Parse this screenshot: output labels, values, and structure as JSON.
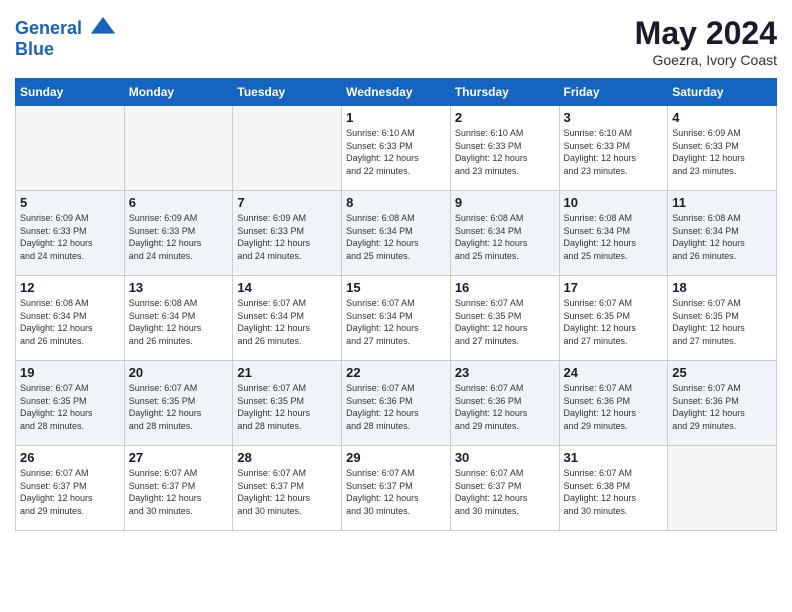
{
  "header": {
    "logo_line1": "General",
    "logo_line2": "Blue",
    "month_year": "May 2024",
    "location": "Goezra, Ivory Coast"
  },
  "weekdays": [
    "Sunday",
    "Monday",
    "Tuesday",
    "Wednesday",
    "Thursday",
    "Friday",
    "Saturday"
  ],
  "weeks": [
    [
      {
        "day": "",
        "info": ""
      },
      {
        "day": "",
        "info": ""
      },
      {
        "day": "",
        "info": ""
      },
      {
        "day": "1",
        "info": "Sunrise: 6:10 AM\nSunset: 6:33 PM\nDaylight: 12 hours\nand 22 minutes."
      },
      {
        "day": "2",
        "info": "Sunrise: 6:10 AM\nSunset: 6:33 PM\nDaylight: 12 hours\nand 23 minutes."
      },
      {
        "day": "3",
        "info": "Sunrise: 6:10 AM\nSunset: 6:33 PM\nDaylight: 12 hours\nand 23 minutes."
      },
      {
        "day": "4",
        "info": "Sunrise: 6:09 AM\nSunset: 6:33 PM\nDaylight: 12 hours\nand 23 minutes."
      }
    ],
    [
      {
        "day": "5",
        "info": "Sunrise: 6:09 AM\nSunset: 6:33 PM\nDaylight: 12 hours\nand 24 minutes."
      },
      {
        "day": "6",
        "info": "Sunrise: 6:09 AM\nSunset: 6:33 PM\nDaylight: 12 hours\nand 24 minutes."
      },
      {
        "day": "7",
        "info": "Sunrise: 6:09 AM\nSunset: 6:33 PM\nDaylight: 12 hours\nand 24 minutes."
      },
      {
        "day": "8",
        "info": "Sunrise: 6:08 AM\nSunset: 6:34 PM\nDaylight: 12 hours\nand 25 minutes."
      },
      {
        "day": "9",
        "info": "Sunrise: 6:08 AM\nSunset: 6:34 PM\nDaylight: 12 hours\nand 25 minutes."
      },
      {
        "day": "10",
        "info": "Sunrise: 6:08 AM\nSunset: 6:34 PM\nDaylight: 12 hours\nand 25 minutes."
      },
      {
        "day": "11",
        "info": "Sunrise: 6:08 AM\nSunset: 6:34 PM\nDaylight: 12 hours\nand 26 minutes."
      }
    ],
    [
      {
        "day": "12",
        "info": "Sunrise: 6:08 AM\nSunset: 6:34 PM\nDaylight: 12 hours\nand 26 minutes."
      },
      {
        "day": "13",
        "info": "Sunrise: 6:08 AM\nSunset: 6:34 PM\nDaylight: 12 hours\nand 26 minutes."
      },
      {
        "day": "14",
        "info": "Sunrise: 6:07 AM\nSunset: 6:34 PM\nDaylight: 12 hours\nand 26 minutes."
      },
      {
        "day": "15",
        "info": "Sunrise: 6:07 AM\nSunset: 6:34 PM\nDaylight: 12 hours\nand 27 minutes."
      },
      {
        "day": "16",
        "info": "Sunrise: 6:07 AM\nSunset: 6:35 PM\nDaylight: 12 hours\nand 27 minutes."
      },
      {
        "day": "17",
        "info": "Sunrise: 6:07 AM\nSunset: 6:35 PM\nDaylight: 12 hours\nand 27 minutes."
      },
      {
        "day": "18",
        "info": "Sunrise: 6:07 AM\nSunset: 6:35 PM\nDaylight: 12 hours\nand 27 minutes."
      }
    ],
    [
      {
        "day": "19",
        "info": "Sunrise: 6:07 AM\nSunset: 6:35 PM\nDaylight: 12 hours\nand 28 minutes."
      },
      {
        "day": "20",
        "info": "Sunrise: 6:07 AM\nSunset: 6:35 PM\nDaylight: 12 hours\nand 28 minutes."
      },
      {
        "day": "21",
        "info": "Sunrise: 6:07 AM\nSunset: 6:35 PM\nDaylight: 12 hours\nand 28 minutes."
      },
      {
        "day": "22",
        "info": "Sunrise: 6:07 AM\nSunset: 6:36 PM\nDaylight: 12 hours\nand 28 minutes."
      },
      {
        "day": "23",
        "info": "Sunrise: 6:07 AM\nSunset: 6:36 PM\nDaylight: 12 hours\nand 29 minutes."
      },
      {
        "day": "24",
        "info": "Sunrise: 6:07 AM\nSunset: 6:36 PM\nDaylight: 12 hours\nand 29 minutes."
      },
      {
        "day": "25",
        "info": "Sunrise: 6:07 AM\nSunset: 6:36 PM\nDaylight: 12 hours\nand 29 minutes."
      }
    ],
    [
      {
        "day": "26",
        "info": "Sunrise: 6:07 AM\nSunset: 6:37 PM\nDaylight: 12 hours\nand 29 minutes."
      },
      {
        "day": "27",
        "info": "Sunrise: 6:07 AM\nSunset: 6:37 PM\nDaylight: 12 hours\nand 30 minutes."
      },
      {
        "day": "28",
        "info": "Sunrise: 6:07 AM\nSunset: 6:37 PM\nDaylight: 12 hours\nand 30 minutes."
      },
      {
        "day": "29",
        "info": "Sunrise: 6:07 AM\nSunset: 6:37 PM\nDaylight: 12 hours\nand 30 minutes."
      },
      {
        "day": "30",
        "info": "Sunrise: 6:07 AM\nSunset: 6:37 PM\nDaylight: 12 hours\nand 30 minutes."
      },
      {
        "day": "31",
        "info": "Sunrise: 6:07 AM\nSunset: 6:38 PM\nDaylight: 12 hours\nand 30 minutes."
      },
      {
        "day": "",
        "info": ""
      }
    ]
  ]
}
